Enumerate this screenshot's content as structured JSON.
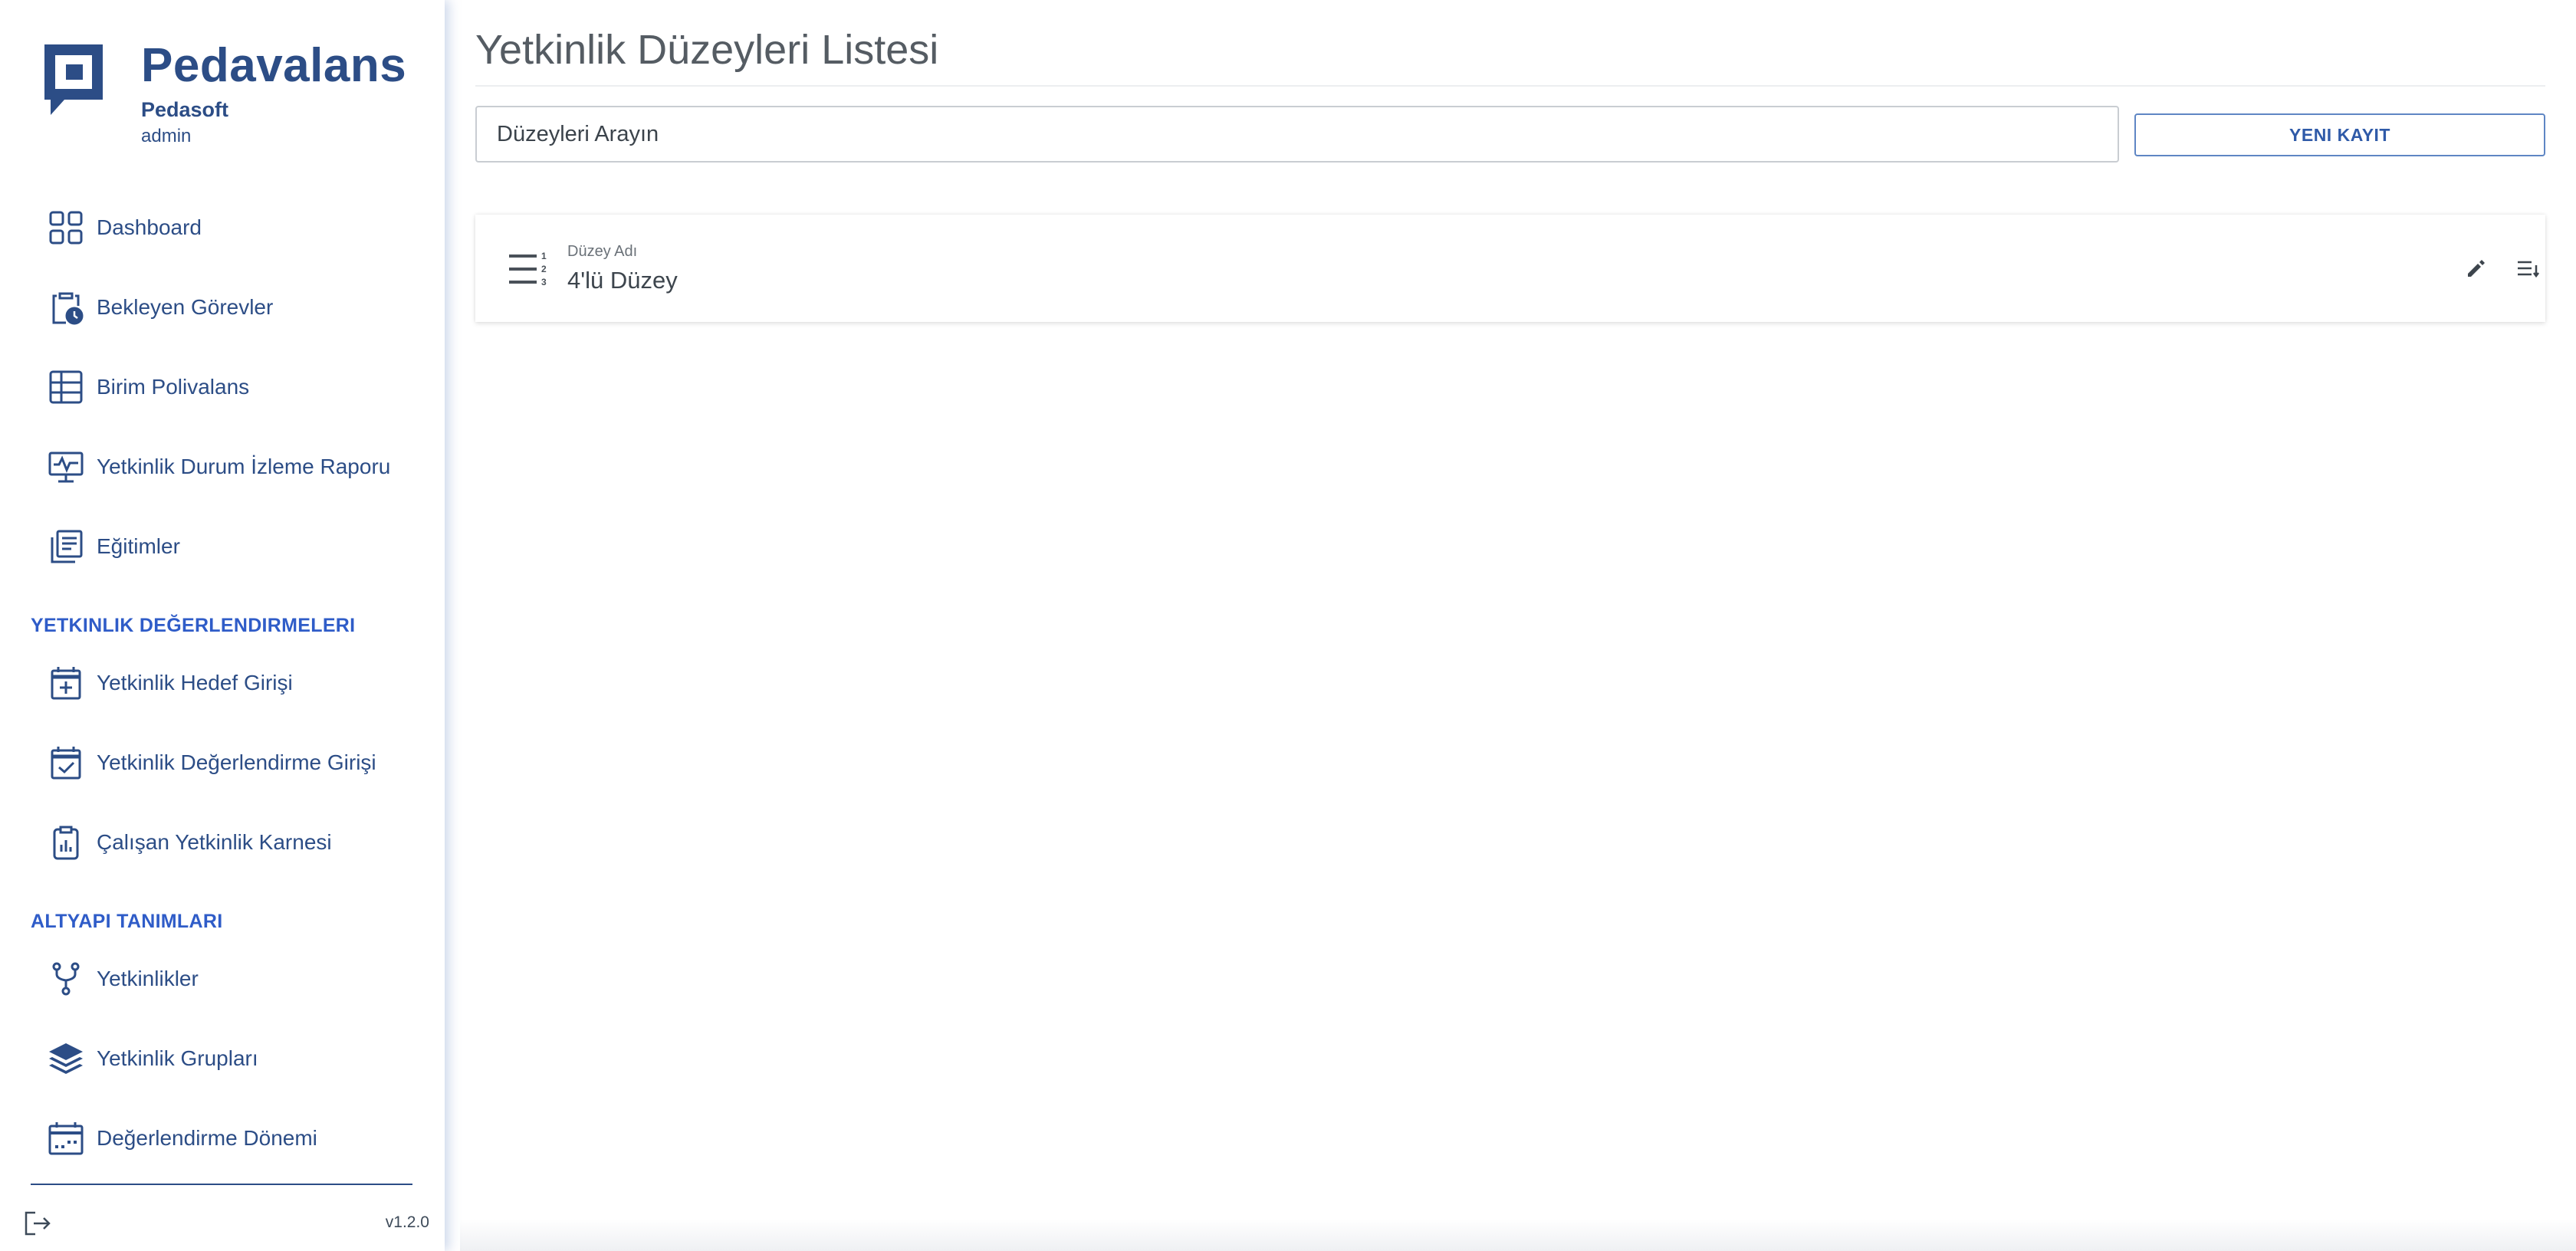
{
  "brand": {
    "name": "Pedavalans",
    "org": "Pedasoft",
    "user": "admin"
  },
  "colors": {
    "brand": "#2c4d86",
    "section": "#2f5cc8",
    "button": "#2f5aa8"
  },
  "sidebar": {
    "items": [
      {
        "label": "Dashboard",
        "icon": "dashboard-icon"
      },
      {
        "label": "Bekleyen Görevler",
        "icon": "clipboard-clock-icon"
      },
      {
        "label": "Birim Polivalans",
        "icon": "table-grid-icon"
      },
      {
        "label": "Yetkinlik Durum İzleme Raporu",
        "icon": "monitor-pulse-icon"
      },
      {
        "label": "Eğitimler",
        "icon": "documents-icon"
      }
    ],
    "section1": {
      "title": "YETKINLIK DEĞERLENDIRMELERI",
      "items": [
        {
          "label": "Yetkinlik Hedef Girişi",
          "icon": "calendar-plus-icon"
        },
        {
          "label": "Yetkinlik Değerlendirme Girişi",
          "icon": "calendar-check-icon"
        },
        {
          "label": "Çalışan Yetkinlik Karnesi",
          "icon": "clipboard-chart-icon"
        }
      ]
    },
    "section2": {
      "title": "ALTYAPI TANIMLARI",
      "items": [
        {
          "label": "Yetkinlikler",
          "icon": "fork-icon"
        },
        {
          "label": "Yetkinlik Grupları",
          "icon": "layers-icon"
        },
        {
          "label": "Değerlendirme Dönemi",
          "icon": "calendar-dots-icon"
        }
      ]
    },
    "version": "v1.2.0"
  },
  "main": {
    "title": "Yetkinlik Düzeyleri Listesi",
    "search": {
      "placeholder": "Düzeyleri Arayın",
      "value": ""
    },
    "new_button": "YENI KAYIT",
    "rows": [
      {
        "label": "Düzey Adı",
        "value": "4'lü Düzey"
      }
    ]
  }
}
